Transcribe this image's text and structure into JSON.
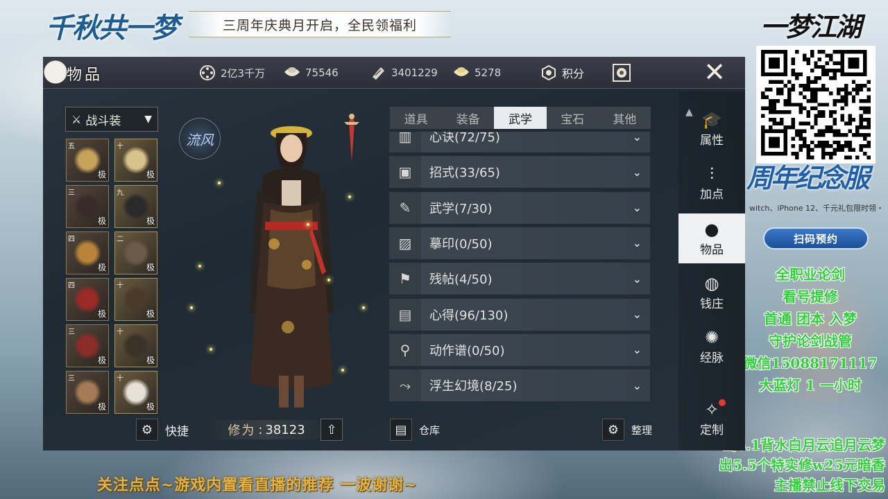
{
  "overlay": {
    "logo_left": "千秋共一梦",
    "banner": "三周年庆典月开启，全民领福利",
    "logo_right": "一梦江湖",
    "anniversary": "周年纪念服",
    "anniversary_sub": "witch、iPhone 12、千元礼包限时领・",
    "reserve_button": "扫码预约",
    "side_notes": [
      "全职业论剑",
      "看号提修",
      "首通 团本 入梦",
      "守护论剑战管",
      "微信15088171117",
      "大蓝灯 1 一小时"
    ],
    "bottom_notes": [
      "出5.1背水白月云追月云梦",
      "出5.5个特实修w25元暗香",
      "主播禁止线下交易"
    ],
    "ticker": "关注点点~游戏内置看直播的推荐 一波谢谢~"
  },
  "game": {
    "title": "物品",
    "currencies": [
      {
        "icon": "film-reel-icon",
        "value": "2亿3千万"
      },
      {
        "icon": "silver-ingot-icon",
        "value": "75546"
      },
      {
        "icon": "jade-ticket-icon",
        "value": "3401229"
      },
      {
        "icon": "gold-ingot-icon",
        "value": "5278"
      },
      {
        "icon": "points-badge-icon",
        "value": "积分"
      }
    ],
    "loadout": "战斗装",
    "school": "流风",
    "equipment": [
      {
        "rank": "五",
        "grade": "极",
        "color": "#c7a25a"
      },
      {
        "rank": "十",
        "grade": "极",
        "color": "#d6c28a"
      },
      {
        "rank": "三",
        "grade": "极",
        "color": "#3a2b2b"
      },
      {
        "rank": "九",
        "grade": "极",
        "color": "#2a2a2a"
      },
      {
        "rank": "四",
        "grade": "极",
        "color": "#b8843a"
      },
      {
        "rank": "二",
        "grade": "极",
        "color": "#6b5a4a"
      },
      {
        "rank": "四",
        "grade": "极",
        "color": "#9a2a25"
      },
      {
        "rank": "十",
        "grade": "极",
        "color": "#4a3a2a"
      },
      {
        "rank": "三",
        "grade": "极",
        "color": "#8a2c28"
      },
      {
        "rank": "十",
        "grade": "极",
        "color": "#3a3226"
      },
      {
        "rank": "三",
        "grade": "极",
        "color": "#a57a56"
      },
      {
        "rank": "十",
        "grade": "极",
        "color": "#e6e0d6"
      }
    ],
    "shortcut_label": "快捷",
    "cultivation_label": "修为",
    "cultivation_value": "38123",
    "tabs": [
      "道具",
      "装备",
      "武学",
      "宝石",
      "其他"
    ],
    "active_tab": "武学",
    "categories": [
      {
        "name": "心诀(72/75)",
        "icon": "scroll-icon"
      },
      {
        "name": "招式(33/65)",
        "icon": "book-icon"
      },
      {
        "name": "武学(7/30)",
        "icon": "manual-icon"
      },
      {
        "name": "摹印(0/50)",
        "icon": "seal-icon"
      },
      {
        "name": "残帖(4/50)",
        "icon": "torn-page-icon"
      },
      {
        "name": "心得(96/130)",
        "icon": "notes-icon"
      },
      {
        "name": "动作谱(0/50)",
        "icon": "action-icon"
      },
      {
        "name": "浮生幻境(8/25)",
        "icon": "dream-icon"
      }
    ],
    "warehouse_label": "仓库",
    "sort_label": "整理",
    "nav": [
      {
        "label": "属性",
        "icon": "hat-icon"
      },
      {
        "label": "加点",
        "icon": "sliders-icon"
      },
      {
        "label": "物品",
        "icon": "bag-icon",
        "active": true
      },
      {
        "label": "钱庄",
        "icon": "money-bag-icon"
      },
      {
        "label": "经脉",
        "icon": "meridian-icon"
      },
      {
        "label": "定制",
        "icon": "magic-wand-icon"
      }
    ]
  }
}
